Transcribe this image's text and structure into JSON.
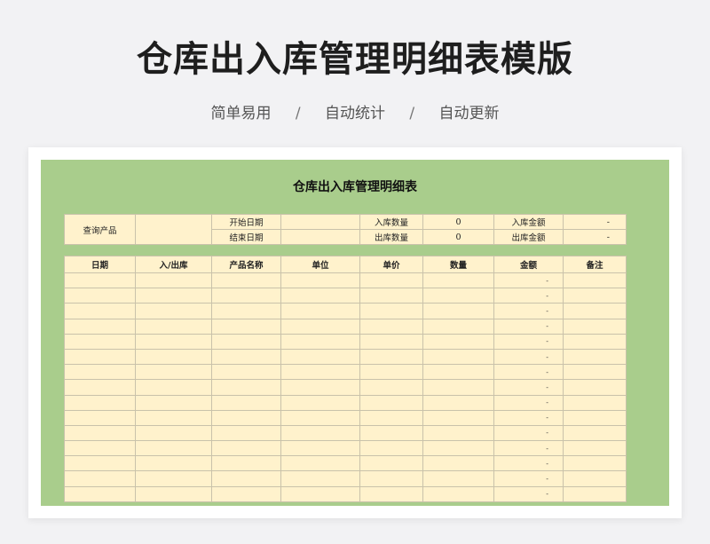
{
  "page": {
    "title": "仓库出入库管理明细表模版",
    "tags": [
      "简单易用",
      "自动统计",
      "自动更新"
    ],
    "separator": "/"
  },
  "sheet": {
    "title": "仓库出入库管理明细表",
    "summary": {
      "query_label": "查询产品",
      "start_date_label": "开始日期",
      "end_date_label": "结束日期",
      "in_qty_label": "入库数量",
      "in_qty_value": "0",
      "out_qty_label": "出库数量",
      "out_qty_value": "0",
      "in_amount_label": "入库金额",
      "in_amount_value": "-",
      "out_amount_label": "出库金额",
      "out_amount_value": "-"
    },
    "columns": [
      "日期",
      "入/出库",
      "产品名称",
      "单位",
      "单价",
      "数量",
      "金额",
      "备注"
    ],
    "row_amounts": [
      "-",
      "-",
      "-",
      "-",
      "-",
      "-",
      "-",
      "-",
      "-",
      "-",
      "-",
      "-",
      "-",
      "-",
      "-"
    ]
  }
}
